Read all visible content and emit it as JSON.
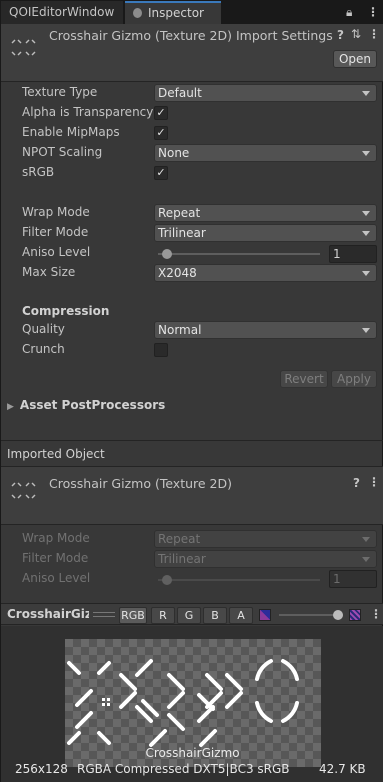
{
  "tabs": [
    {
      "label": "QOIEditorWindow"
    },
    {
      "label": "Inspector"
    }
  ],
  "header": {
    "title": "Crosshair Gizmo (Texture 2D) Import Settings",
    "open_label": "Open"
  },
  "settings": {
    "texture_type": {
      "label": "Texture Type",
      "value": "Default"
    },
    "alpha_is_transparency": {
      "label": "Alpha is Transparency",
      "checked": true
    },
    "enable_mipmaps": {
      "label": "Enable MipMaps",
      "checked": true
    },
    "npot_scaling": {
      "label": "NPOT Scaling",
      "value": "None"
    },
    "srgb": {
      "label": "sRGB",
      "checked": true
    },
    "wrap_mode": {
      "label": "Wrap Mode",
      "value": "Repeat"
    },
    "filter_mode": {
      "label": "Filter Mode",
      "value": "Trilinear"
    },
    "aniso_level": {
      "label": "Aniso Level",
      "value": "1",
      "level_fraction": 0.0
    },
    "max_size": {
      "label": "Max Size",
      "value": "X2048"
    },
    "compression_heading": "Compression",
    "quality": {
      "label": "Quality",
      "value": "Normal"
    },
    "crunch": {
      "label": "Crunch",
      "checked": false
    },
    "revert_label": "Revert",
    "apply_label": "Apply",
    "postprocessors_label": "Asset PostProcessors"
  },
  "imported": {
    "section_label": "Imported Object",
    "title": "Crosshair Gizmo (Texture 2D)",
    "wrap_mode": {
      "label": "Wrap Mode",
      "value": "Repeat"
    },
    "filter_mode": {
      "label": "Filter Mode",
      "value": "Trilinear"
    },
    "aniso_level": {
      "label": "Aniso Level",
      "value": "1"
    }
  },
  "preview": {
    "name_short": "CrosshairGiz",
    "channels": [
      "RGB",
      "R",
      "G",
      "B",
      "A"
    ],
    "overlay_name": "CrosshairGizmo",
    "dimensions": "256x128",
    "format": "RGBA Compressed DXT5|BC3 sRGB",
    "size": "42.7 KB"
  },
  "colors": {
    "accent": "#3a79bb",
    "panel": "#383838"
  }
}
